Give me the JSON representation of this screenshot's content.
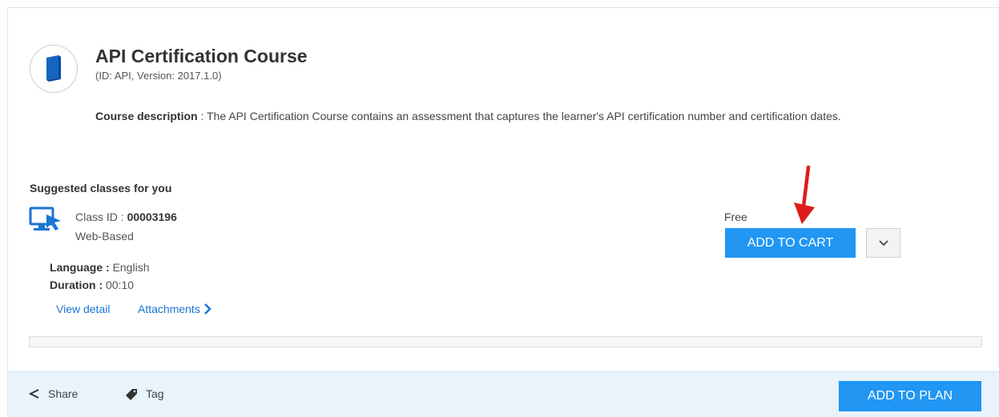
{
  "course": {
    "title": "API Certification Course",
    "subtitle": "(ID: API, Version: 2017.1.0)",
    "description_label": "Course description",
    "description_text": " : The API Certification Course contains an assessment that captures the learner's API certification number and certification dates.",
    "icon": "book-icon"
  },
  "suggested": {
    "heading": "Suggested classes for you",
    "class_id_label": "Class ID : ",
    "class_id": "00003196",
    "class_type": "Web-Based",
    "language_label": "Language : ",
    "language": "English",
    "duration_label": "Duration : ",
    "duration": "00:10",
    "view_detail": "View detail",
    "attachments": "Attachments",
    "price": "Free",
    "add_to_cart": "ADD TO CART",
    "icon": "web-based-class-icon"
  },
  "footer": {
    "share": "Share",
    "tag": "Tag",
    "add_to_plan": "ADD TO PLAN"
  },
  "colors": {
    "primary": "#2196f3",
    "link": "#1976d2",
    "footer_bg": "#e8f3fc",
    "annotation_arrow": "#e01b1b"
  }
}
